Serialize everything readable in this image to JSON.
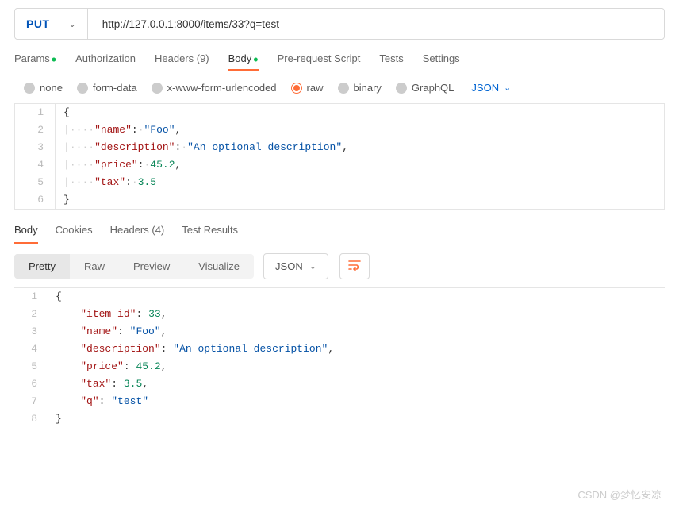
{
  "request": {
    "method": "PUT",
    "url": "http://127.0.0.1:8000/items/33?q=test"
  },
  "reqTabs": {
    "params": "Params",
    "authorization": "Authorization",
    "headers": "Headers (9)",
    "body": "Body",
    "prerequest": "Pre-request Script",
    "tests": "Tests",
    "settings": "Settings"
  },
  "bodyTypes": {
    "none": "none",
    "formdata": "form-data",
    "urlencoded": "x-www-form-urlencoded",
    "raw": "raw",
    "binary": "binary",
    "graphql": "GraphQL",
    "contentType": "JSON"
  },
  "reqBody": {
    "lines": {
      "1": "{",
      "2": {
        "k": "\"name\"",
        "v": "\"Foo\"",
        "c": ","
      },
      "3": {
        "k": "\"description\"",
        "v": "\"An optional description\"",
        "c": ","
      },
      "4": {
        "k": "\"price\"",
        "v": "45.2",
        "c": ","
      },
      "5": {
        "k": "\"tax\"",
        "v": "3.5",
        "c": ""
      },
      "6": "}"
    }
  },
  "respTabs": {
    "body": "Body",
    "cookies": "Cookies",
    "headers": "Headers (4)",
    "testresults": "Test Results"
  },
  "viewModes": {
    "pretty": "Pretty",
    "raw": "Raw",
    "preview": "Preview",
    "visualize": "Visualize",
    "type": "JSON"
  },
  "respBody": {
    "lines": {
      "1": "{",
      "2": {
        "k": "\"item_id\"",
        "v": "33",
        "num": true,
        "c": ","
      },
      "3": {
        "k": "\"name\"",
        "v": "\"Foo\"",
        "c": ","
      },
      "4": {
        "k": "\"description\"",
        "v": "\"An optional description\"",
        "c": ","
      },
      "5": {
        "k": "\"price\"",
        "v": "45.2",
        "num": true,
        "c": ","
      },
      "6": {
        "k": "\"tax\"",
        "v": "3.5",
        "num": true,
        "c": ","
      },
      "7": {
        "k": "\"q\"",
        "v": "\"test\"",
        "c": ""
      },
      "8": "}"
    }
  },
  "watermark": "CSDN @梦忆安凉"
}
